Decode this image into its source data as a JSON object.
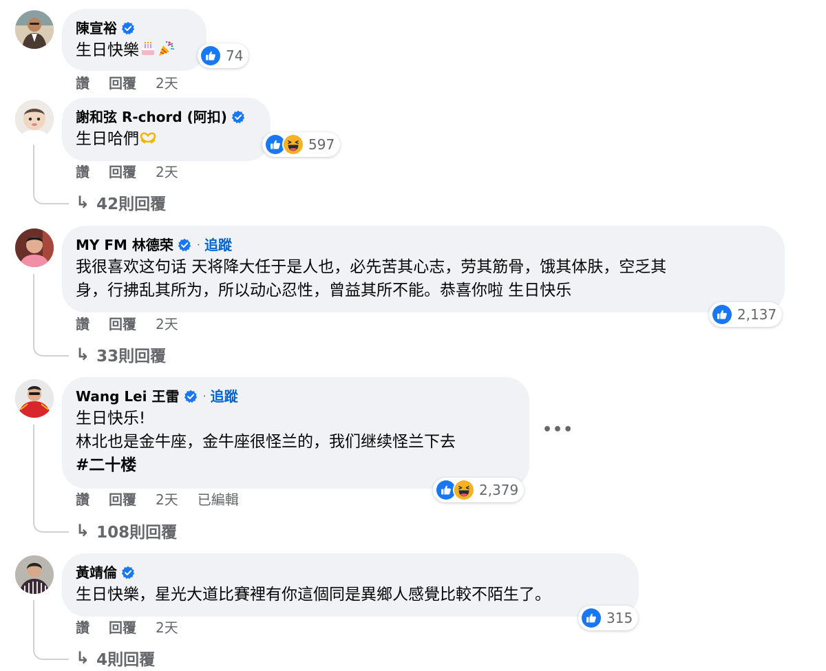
{
  "comments": [
    {
      "author": "陳宣裕",
      "text": "生日快樂",
      "emojis": [
        "birthday-cake",
        "party-popper"
      ],
      "reactions": [
        "like"
      ],
      "reaction_count": "74",
      "actions": {
        "like": "讚",
        "reply": "回覆",
        "time": "2天"
      }
    },
    {
      "author": "謝和弦 R-chord (阿扣)",
      "text": "生日哈們",
      "emojis": [
        "heart-hands"
      ],
      "reactions": [
        "like",
        "haha"
      ],
      "reaction_count": "597",
      "actions": {
        "like": "讚",
        "reply": "回覆",
        "time": "2天"
      },
      "replies": "42則回覆"
    },
    {
      "author": "MY FM 林德荣",
      "follow": "追蹤",
      "text_line1": "我很喜欢这句话 天将降大任于是人也，必先苦其心志，劳其筋骨，饿其体肤，空乏其",
      "text_line2": "身，行拂乱其所为，所以动心忍性，曾益其所不能。恭喜你啦 生日快乐",
      "reactions": [
        "like"
      ],
      "reaction_count": "2,137",
      "actions": {
        "like": "讚",
        "reply": "回覆",
        "time": "2天"
      },
      "replies": "33則回覆"
    },
    {
      "author": "Wang Lei 王雷",
      "follow": "追蹤",
      "text_line1": "生日快乐!",
      "text_line2": "林北也是金牛座，金牛座很怪兰的，我们继续怪兰下去",
      "hashtag": "#二十楼",
      "reactions": [
        "like",
        "haha"
      ],
      "reaction_count": "2,379",
      "actions": {
        "like": "讚",
        "reply": "回覆",
        "time": "2天",
        "edited": "已編輯"
      },
      "replies": "108則回覆",
      "more": "•••"
    },
    {
      "author": "黃靖倫",
      "text": "生日快樂，星光大道比賽裡有你這個同是異鄉人感覺比較不陌生了。",
      "reactions": [
        "like"
      ],
      "reaction_count": "315",
      "actions": {
        "like": "讚",
        "reply": "回覆",
        "time": "2天"
      },
      "replies": "4則回覆"
    }
  ],
  "colors": {
    "bubble": "#f0f2f5",
    "meta": "#65676b",
    "link": "#0064d1",
    "verified": "#1877f2",
    "like": "#1877f2",
    "haha": "#f7b125"
  }
}
